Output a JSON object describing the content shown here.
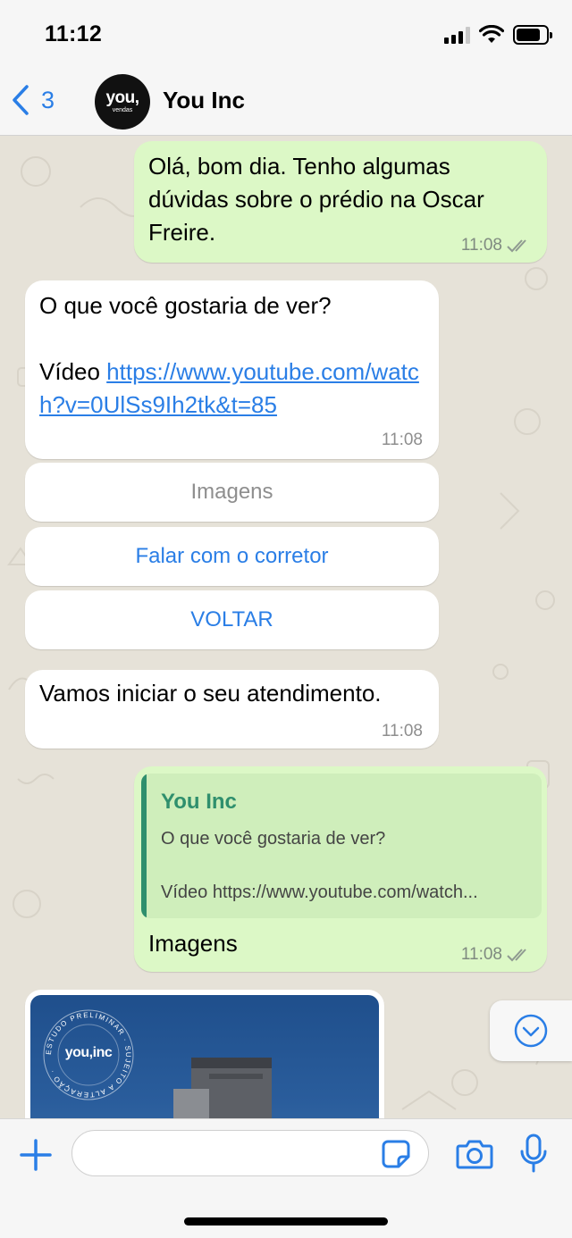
{
  "status_bar": {
    "time": "11:12"
  },
  "header": {
    "back_count": "3",
    "avatar_main": "you,",
    "avatar_sub": "vendas",
    "contact_name": "You Inc"
  },
  "messages": {
    "m1": {
      "text": "Olá, bom dia. Tenho algumas dúvidas sobre o prédio na Oscar Freire.",
      "time": "11:08"
    },
    "m2": {
      "text": "O que você gostaria de ver?",
      "prefix": "Vídeo ",
      "link": "https://www.youtube.com/watch?v=0UlSs9Ih2tk&t=85",
      "time": "11:08"
    },
    "quick_replies": [
      "Imagens",
      "Falar com o corretor",
      "VOLTAR"
    ],
    "m3": {
      "text": "Vamos iniciar o seu atendimento.",
      "time": "11:08"
    },
    "m4": {
      "quote_name": "You Inc",
      "quote_line1": "O que você gostaria de ver?",
      "quote_line2": "Vídeo https://www.youtube.com/watch...",
      "text": "Imagens",
      "time": "11:08"
    },
    "image": {
      "badge_line1": "you,inc",
      "ring_text": "ESTUDO PRELIMINAR · SUJEITO A ALTERAÇÃO ·"
    }
  },
  "input": {
    "placeholder": ""
  },
  "colors": {
    "accent": "#2a7ee6",
    "outgoing": "#dcf8c6",
    "incoming": "#ffffff",
    "quote_green": "#2f8f6d",
    "chat_bg": "#e6e2d8"
  },
  "icons": [
    "back-chevron-icon",
    "double-check-icon",
    "chevron-down-icon",
    "plus-icon",
    "sticker-icon",
    "camera-icon",
    "microphone-icon"
  ]
}
